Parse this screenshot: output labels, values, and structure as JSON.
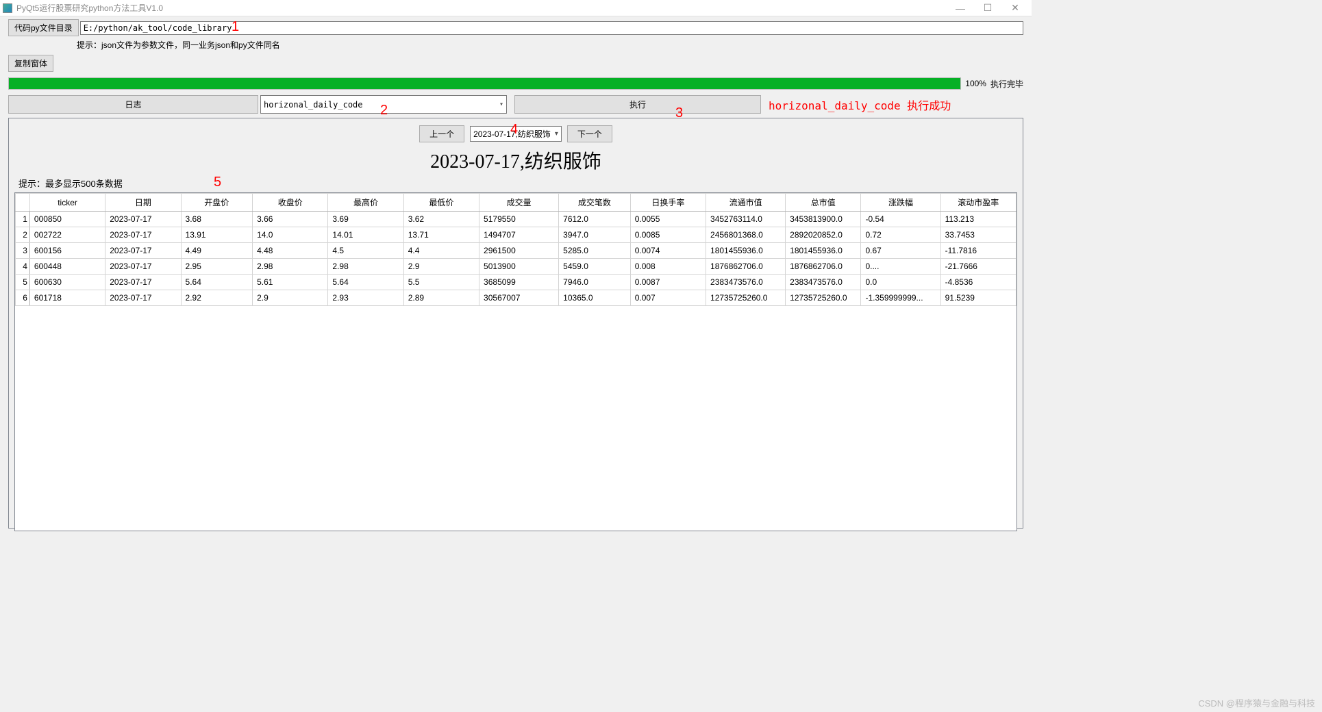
{
  "window": {
    "title": "PyQt5运行股票研究python方法工具V1.0",
    "min": "—",
    "max": "☐",
    "close": "✕"
  },
  "top": {
    "dir_btn": "代码py文件目录",
    "dir_value": "E:/python/ak_tool/code_library",
    "hint": "提示：json文件为参数文件，同一业务json和py文件同名",
    "copy_btn": "复制窗体"
  },
  "progress": {
    "percent": "100%",
    "label": "执行完毕"
  },
  "actions": {
    "log_btn": "日志",
    "combo_value": "horizonal_daily_code",
    "exec_btn": "执行",
    "status": "horizonal_daily_code 执行成功"
  },
  "nav": {
    "prev": "上一个",
    "combo": "2023-07-17,纺织服饰",
    "next": "下一个"
  },
  "title": "2023-07-17,纺织服饰",
  "table_hint": "提示：最多显示500条数据",
  "columns": [
    "ticker",
    "日期",
    "开盘价",
    "收盘价",
    "最高价",
    "最低价",
    "成交量",
    "成交笔数",
    "日换手率",
    "流通市值",
    "总市值",
    "涨跌幅",
    "滚动市盈率"
  ],
  "rows": [
    [
      "000850",
      "2023-07-17",
      "3.68",
      "3.66",
      "3.69",
      "3.62",
      "5179550",
      "7612.0",
      "0.0055",
      "3452763114.0",
      "3453813900.0",
      "-0.54",
      "113.213"
    ],
    [
      "002722",
      "2023-07-17",
      "13.91",
      "14.0",
      "14.01",
      "13.71",
      "1494707",
      "3947.0",
      "0.0085",
      "2456801368.0",
      "2892020852.0",
      "0.72",
      "33.7453"
    ],
    [
      "600156",
      "2023-07-17",
      "4.49",
      "4.48",
      "4.5",
      "4.4",
      "2961500",
      "5285.0",
      "0.0074",
      "1801455936.0",
      "1801455936.0",
      "0.67",
      "-11.7816"
    ],
    [
      "600448",
      "2023-07-17",
      "2.95",
      "2.98",
      "2.98",
      "2.9",
      "5013900",
      "5459.0",
      "0.008",
      "1876862706.0",
      "1876862706.0",
      "0....",
      "-21.7666"
    ],
    [
      "600630",
      "2023-07-17",
      "5.64",
      "5.61",
      "5.64",
      "5.5",
      "3685099",
      "7946.0",
      "0.0087",
      "2383473576.0",
      "2383473576.0",
      "0.0",
      "-4.8536"
    ],
    [
      "601718",
      "2023-07-17",
      "2.92",
      "2.9",
      "2.93",
      "2.89",
      "30567007",
      "10365.0",
      "0.007",
      "12735725260.0",
      "12735725260.0",
      "-1.359999999...",
      "91.5239"
    ]
  ],
  "annotations": {
    "a1": "1",
    "a2": "2",
    "a3": "3",
    "a4": "4",
    "a5": "5"
  },
  "watermark": "CSDN @程序猿与金融与科技"
}
